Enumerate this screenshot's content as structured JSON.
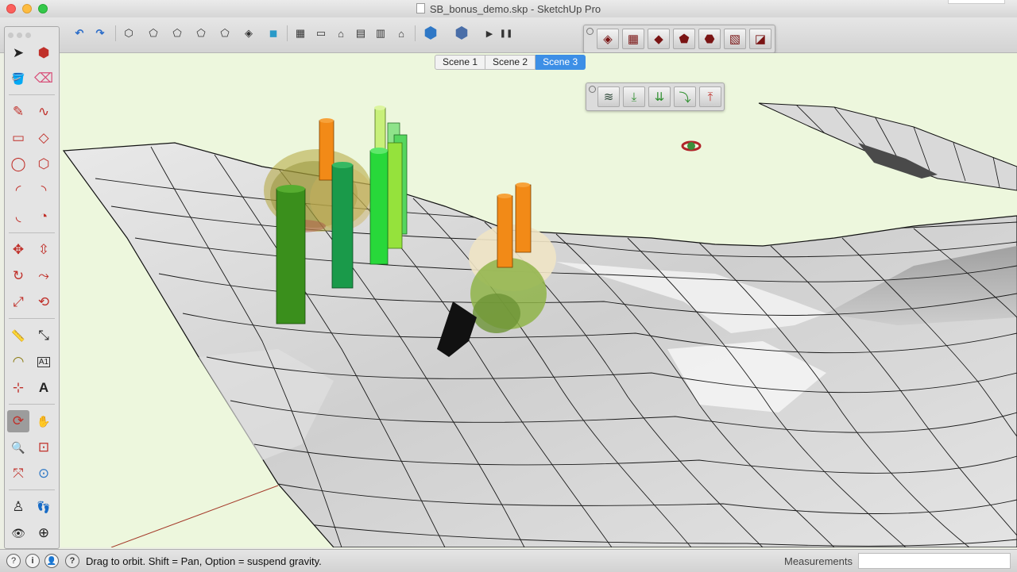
{
  "window": {
    "title": "SB_bonus_demo.skp - SketchUp Pro"
  },
  "scenes": {
    "tabs": [
      "Scene 1",
      "Scene 2",
      "Scene 3"
    ],
    "active": "Scene 3"
  },
  "toolbar": {
    "tools": [
      {
        "name": "undo-icon",
        "glyph": "↶"
      },
      {
        "name": "redo-icon",
        "glyph": "↷"
      },
      {
        "name": "view-iso-icon",
        "glyph": "⬡"
      },
      {
        "name": "view-top-icon",
        "glyph": "⬠"
      },
      {
        "name": "view-front-icon",
        "glyph": "⬠"
      },
      {
        "name": "view-right-icon",
        "glyph": "⬠"
      },
      {
        "name": "view-back-icon",
        "glyph": "⬠"
      },
      {
        "name": "view-left-icon",
        "glyph": "⬠"
      },
      {
        "name": "style-xray-icon",
        "glyph": "◈"
      },
      {
        "name": "style-wireframe-icon",
        "glyph": "◇"
      },
      {
        "name": "style-hidden-line-icon",
        "glyph": "◻"
      },
      {
        "name": "style-shaded-icon",
        "glyph": "◼"
      },
      {
        "name": "style-textured-icon",
        "glyph": "▦"
      },
      {
        "name": "style-monochrome-icon",
        "glyph": "▣"
      },
      {
        "name": "section-plane-icon",
        "glyph": "▭"
      },
      {
        "name": "warehouse-icon",
        "glyph": "⌂"
      },
      {
        "name": "components-icon",
        "glyph": "▤"
      },
      {
        "name": "extension-warehouse-icon",
        "glyph": "▥"
      },
      {
        "name": "share-model-icon",
        "glyph": "⌂"
      },
      {
        "name": "get-models-icon",
        "glyph": "⬢"
      },
      {
        "name": "layout-icon",
        "glyph": "⬢"
      },
      {
        "name": "play-animation-icon",
        "glyph": "▶"
      },
      {
        "name": "pause-animation-icon",
        "glyph": "❚❚"
      }
    ]
  },
  "sandbox_toolbar": {
    "tools": [
      {
        "name": "sandbox-from-contours-icon",
        "glyph": "◈"
      },
      {
        "name": "sandbox-from-scratch-icon",
        "glyph": "▦"
      },
      {
        "name": "smoove-icon",
        "glyph": "◆"
      },
      {
        "name": "stamp-icon",
        "glyph": "⬟"
      },
      {
        "name": "drape-icon",
        "glyph": "⬣"
      },
      {
        "name": "add-detail-icon",
        "glyph": "▧"
      },
      {
        "name": "flip-edge-icon",
        "glyph": "◪"
      }
    ]
  },
  "plugin_toolbar": {
    "tools": [
      {
        "name": "contour-layers-icon",
        "glyph": "≋"
      },
      {
        "name": "drop-to-surface-icon",
        "glyph": "⤓"
      },
      {
        "name": "drop-multiple-icon",
        "glyph": "⇊"
      },
      {
        "name": "drape-edges-icon",
        "glyph": "⤵"
      },
      {
        "name": "raise-object-icon",
        "glyph": "⤒"
      }
    ]
  },
  "palette": {
    "tools": [
      {
        "name": "select-tool-icon",
        "glyph": "➤"
      },
      {
        "name": "make-component-icon",
        "glyph": "⬢"
      },
      {
        "name": "paint-bucket-icon",
        "glyph": "🪣"
      },
      {
        "name": "eraser-icon",
        "glyph": "⌫"
      },
      {
        "name": "line-tool-icon",
        "glyph": "✎"
      },
      {
        "name": "freehand-tool-icon",
        "glyph": "∿"
      },
      {
        "name": "rectangle-tool-icon",
        "glyph": "▭"
      },
      {
        "name": "rotated-rectangle-icon",
        "glyph": "◇"
      },
      {
        "name": "circle-tool-icon",
        "glyph": "◯"
      },
      {
        "name": "polygon-tool-icon",
        "glyph": "⬡"
      },
      {
        "name": "arc-tool-icon",
        "glyph": "◜"
      },
      {
        "name": "two-point-arc-icon",
        "glyph": "◝"
      },
      {
        "name": "three-point-arc-icon",
        "glyph": "◟"
      },
      {
        "name": "pie-tool-icon",
        "glyph": "◔"
      },
      {
        "name": "move-tool-icon",
        "glyph": "✥"
      },
      {
        "name": "push-pull-icon",
        "glyph": "⇳"
      },
      {
        "name": "rotate-tool-icon",
        "glyph": "↻"
      },
      {
        "name": "follow-me-icon",
        "glyph": "⤳"
      },
      {
        "name": "scale-tool-icon",
        "glyph": "⤢"
      },
      {
        "name": "offset-tool-icon",
        "glyph": "⟲"
      },
      {
        "name": "tape-measure-icon",
        "glyph": "📏"
      },
      {
        "name": "dimension-tool-icon",
        "glyph": "⤡"
      },
      {
        "name": "protractor-icon",
        "glyph": "◠"
      },
      {
        "name": "text-tool-icon",
        "glyph": "A1"
      },
      {
        "name": "axes-tool-icon",
        "glyph": "⊹"
      },
      {
        "name": "3d-text-icon",
        "glyph": "A"
      },
      {
        "name": "orbit-tool-icon",
        "glyph": "⟳"
      },
      {
        "name": "pan-tool-icon",
        "glyph": "✋"
      },
      {
        "name": "zoom-tool-icon",
        "glyph": "🔍"
      },
      {
        "name": "zoom-window-icon",
        "glyph": "⊡"
      },
      {
        "name": "zoom-extents-icon",
        "glyph": "⤧"
      },
      {
        "name": "previous-view-icon",
        "glyph": "⊙"
      },
      {
        "name": "position-camera-icon",
        "glyph": "♙"
      },
      {
        "name": "walk-tool-icon",
        "glyph": "👣"
      },
      {
        "name": "look-around-icon",
        "glyph": "👁"
      },
      {
        "name": "section-plane-tool-icon",
        "glyph": "⊕"
      }
    ]
  },
  "statusbar": {
    "hint": "Drag to orbit. Shift = Pan, Option = suspend gravity.",
    "measurements_label": "Measurements",
    "measurements_value": "",
    "icons": [
      {
        "name": "geolocation-icon",
        "glyph": "?"
      },
      {
        "name": "credits-icon",
        "glyph": "i"
      },
      {
        "name": "user-account-icon",
        "glyph": "👤"
      },
      {
        "name": "instructor-icon",
        "glyph": "?"
      }
    ]
  }
}
